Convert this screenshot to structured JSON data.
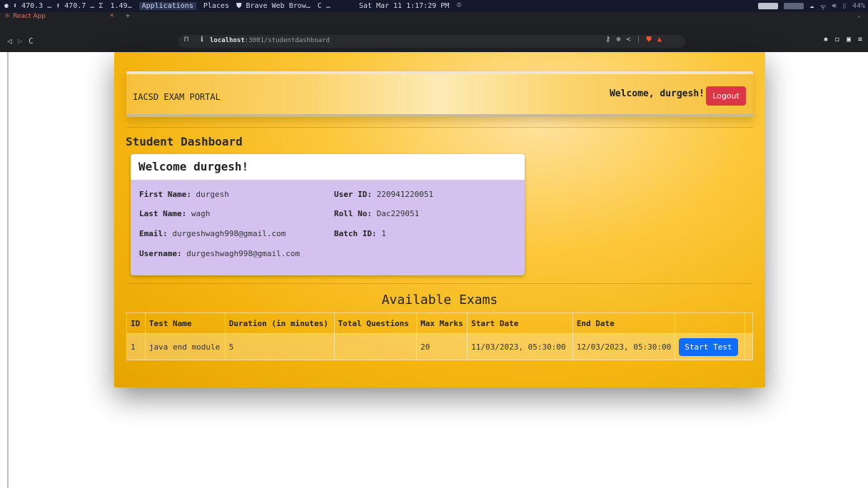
{
  "os_bar": {
    "items": [
      "⚈ ⬇ 470.3 … ⬆ 470.7 … Σ",
      "1.49…",
      "Applications",
      "Places",
      "⛊ Brave Web Brow…",
      "C …",
      "Sat Mar 11  1:17:29 PM",
      "⯐"
    ],
    "battery": "44%"
  },
  "browser": {
    "tab_title": "React App",
    "url_host": "localhost",
    "url_rest": ":3001/studentdashboard"
  },
  "header": {
    "brand": "IACSD EXAM PORTAL",
    "welcome": "Welcome, durgesh!",
    "logout_label": "Logout"
  },
  "dashboard": {
    "title": "Student Dashboard",
    "card_title": "Welcome durgesh!",
    "fields": {
      "first_name_label": "First Name:",
      "first_name": "durgesh",
      "last_name_label": "Last Name:",
      "last_name": "wagh",
      "email_label": "Email:",
      "email": "durgeshwagh998@gmail.com",
      "username_label": "Username:",
      "username": "durgeshwagh998@gmail.com",
      "user_id_label": "User ID:",
      "user_id": "220941220051",
      "roll_no_label": "Roll No:",
      "roll_no": "Dac229051",
      "batch_id_label": "Batch ID:",
      "batch_id": "1"
    }
  },
  "exams": {
    "title": "Available Exams",
    "columns": [
      "ID",
      "Test Name",
      "Duration (in minutes)",
      "Total Questions",
      "Max Marks",
      "Start Date",
      "End Date",
      "",
      ""
    ],
    "rows": [
      [
        "1",
        "java end module",
        "5",
        "",
        "20",
        "11/03/2023, 05:30:00",
        "12/03/2023, 05:30:00"
      ]
    ],
    "start_label": "Start Test"
  },
  "colors": {
    "danger": "#dc3545",
    "primary": "#0d6efd",
    "card": "#d4c1ef",
    "accent": "#f4b40f"
  }
}
